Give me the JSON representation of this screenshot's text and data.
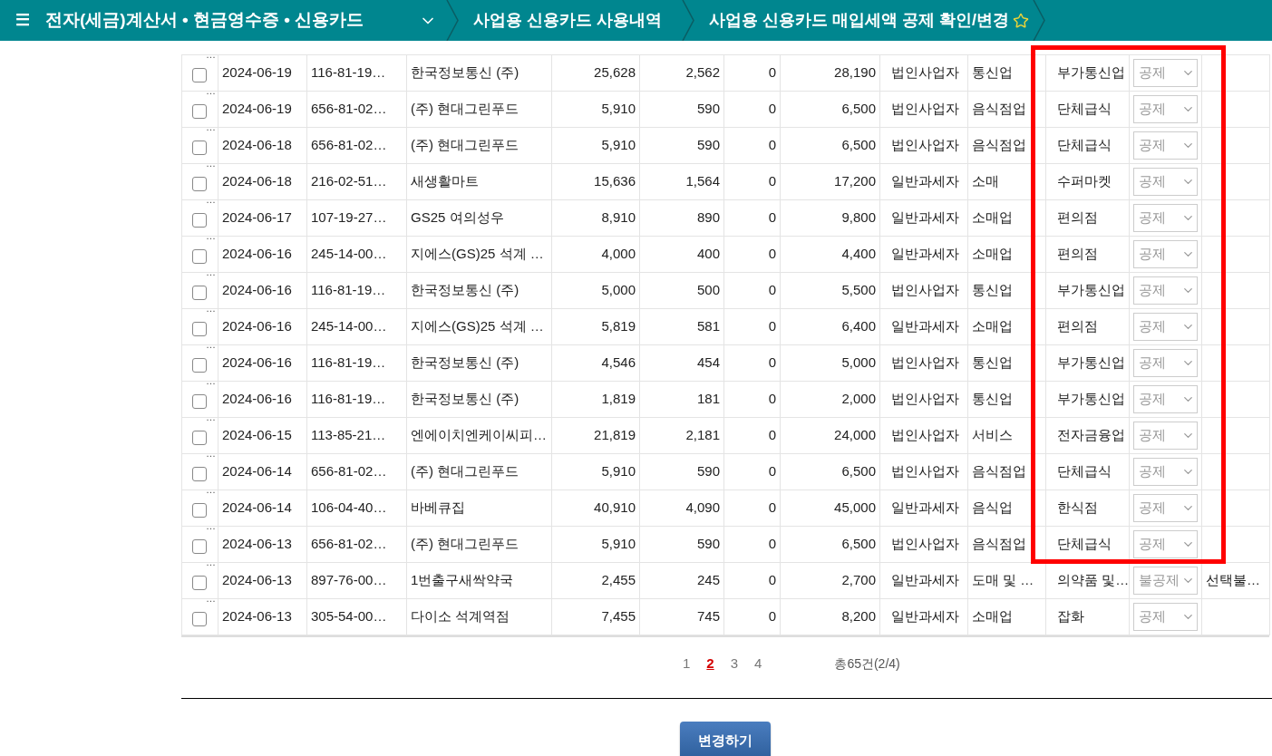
{
  "header": {
    "menu_icon": "☰",
    "title": "전자(세금)계산서 • 현금영수증 • 신용카드",
    "breadcrumbs": [
      {
        "label": "사업용 신용카드 사용내역",
        "favorite": false
      },
      {
        "label": "사업용 신용카드 매입세액 공제 확인/변경",
        "favorite": true
      }
    ]
  },
  "table": {
    "rows": [
      {
        "flag": "…",
        "checked": false,
        "date": "2024-06-19",
        "biz_no": "116-81-19…",
        "merchant": "한국정보통신 (주)",
        "supply": "25,628",
        "tax": "2,562",
        "service": "0",
        "total": "28,190",
        "taxpayer_type": "법인사업자",
        "industry": "통신업",
        "detail": "부가통신업",
        "deduction": "공제",
        "note": ""
      },
      {
        "flag": "…",
        "checked": false,
        "date": "2024-06-19",
        "biz_no": "656-81-02…",
        "merchant": "(주) 현대그린푸드",
        "supply": "5,910",
        "tax": "590",
        "service": "0",
        "total": "6,500",
        "taxpayer_type": "법인사업자",
        "industry": "음식점업",
        "detail": "단체급식",
        "deduction": "공제",
        "note": ""
      },
      {
        "flag": "…",
        "checked": false,
        "date": "2024-06-18",
        "biz_no": "656-81-02…",
        "merchant": "(주) 현대그린푸드",
        "supply": "5,910",
        "tax": "590",
        "service": "0",
        "total": "6,500",
        "taxpayer_type": "법인사업자",
        "industry": "음식점업",
        "detail": "단체급식",
        "deduction": "공제",
        "note": ""
      },
      {
        "flag": "…",
        "checked": false,
        "date": "2024-06-18",
        "biz_no": "216-02-51…",
        "merchant": "새생활마트",
        "supply": "15,636",
        "tax": "1,564",
        "service": "0",
        "total": "17,200",
        "taxpayer_type": "일반과세자",
        "industry": "소매",
        "detail": "수퍼마켓",
        "deduction": "공제",
        "note": ""
      },
      {
        "flag": "…",
        "checked": false,
        "date": "2024-06-17",
        "biz_no": "107-19-27…",
        "merchant": "GS25 여의성우",
        "supply": "8,910",
        "tax": "890",
        "service": "0",
        "total": "9,800",
        "taxpayer_type": "일반과세자",
        "industry": "소매업",
        "detail": "편의점",
        "deduction": "공제",
        "note": ""
      },
      {
        "flag": "…",
        "checked": false,
        "date": "2024-06-16",
        "biz_no": "245-14-00…",
        "merchant": "지에스(GS)25 석계 …",
        "supply": "4,000",
        "tax": "400",
        "service": "0",
        "total": "4,400",
        "taxpayer_type": "일반과세자",
        "industry": "소매업",
        "detail": "편의점",
        "deduction": "공제",
        "note": ""
      },
      {
        "flag": "…",
        "checked": false,
        "date": "2024-06-16",
        "biz_no": "116-81-19…",
        "merchant": "한국정보통신 (주)",
        "supply": "5,000",
        "tax": "500",
        "service": "0",
        "total": "5,500",
        "taxpayer_type": "법인사업자",
        "industry": "통신업",
        "detail": "부가통신업",
        "deduction": "공제",
        "note": ""
      },
      {
        "flag": "…",
        "checked": false,
        "date": "2024-06-16",
        "biz_no": "245-14-00…",
        "merchant": "지에스(GS)25 석계 …",
        "supply": "5,819",
        "tax": "581",
        "service": "0",
        "total": "6,400",
        "taxpayer_type": "일반과세자",
        "industry": "소매업",
        "detail": "편의점",
        "deduction": "공제",
        "note": ""
      },
      {
        "flag": "…",
        "checked": false,
        "date": "2024-06-16",
        "biz_no": "116-81-19…",
        "merchant": "한국정보통신 (주)",
        "supply": "4,546",
        "tax": "454",
        "service": "0",
        "total": "5,000",
        "taxpayer_type": "법인사업자",
        "industry": "통신업",
        "detail": "부가통신업",
        "deduction": "공제",
        "note": ""
      },
      {
        "flag": "…",
        "checked": false,
        "date": "2024-06-16",
        "biz_no": "116-81-19…",
        "merchant": "한국정보통신 (주)",
        "supply": "1,819",
        "tax": "181",
        "service": "0",
        "total": "2,000",
        "taxpayer_type": "법인사업자",
        "industry": "통신업",
        "detail": "부가통신업",
        "deduction": "공제",
        "note": ""
      },
      {
        "flag": "…",
        "checked": false,
        "date": "2024-06-15",
        "biz_no": "113-85-21…",
        "merchant": "엔에이치엔케이씨피…",
        "supply": "21,819",
        "tax": "2,181",
        "service": "0",
        "total": "24,000",
        "taxpayer_type": "법인사업자",
        "industry": "서비스",
        "detail": "전자금융업",
        "deduction": "공제",
        "note": ""
      },
      {
        "flag": "…",
        "checked": false,
        "date": "2024-06-14",
        "biz_no": "656-81-02…",
        "merchant": "(주) 현대그린푸드",
        "supply": "5,910",
        "tax": "590",
        "service": "0",
        "total": "6,500",
        "taxpayer_type": "법인사업자",
        "industry": "음식점업",
        "detail": "단체급식",
        "deduction": "공제",
        "note": ""
      },
      {
        "flag": "…",
        "checked": false,
        "date": "2024-06-14",
        "biz_no": "106-04-40…",
        "merchant": "바베큐집",
        "supply": "40,910",
        "tax": "4,090",
        "service": "0",
        "total": "45,000",
        "taxpayer_type": "일반과세자",
        "industry": "음식업",
        "detail": "한식점",
        "deduction": "공제",
        "note": ""
      },
      {
        "flag": "…",
        "checked": false,
        "date": "2024-06-13",
        "biz_no": "656-81-02…",
        "merchant": "(주) 현대그린푸드",
        "supply": "5,910",
        "tax": "590",
        "service": "0",
        "total": "6,500",
        "taxpayer_type": "법인사업자",
        "industry": "음식점업",
        "detail": "단체급식",
        "deduction": "공제",
        "note": ""
      },
      {
        "flag": "…",
        "checked": false,
        "date": "2024-06-13",
        "biz_no": "897-76-00…",
        "merchant": "1번출구새싹약국",
        "supply": "2,455",
        "tax": "245",
        "service": "0",
        "total": "2,700",
        "taxpayer_type": "일반과세자",
        "industry": "도매 및 …",
        "detail": "의약품 및…",
        "deduction": "불공제",
        "note": "선택불…"
      },
      {
        "flag": "…",
        "checked": false,
        "date": "2024-06-13",
        "biz_no": "305-54-00…",
        "merchant": "다이소 석계역점",
        "supply": "7,455",
        "tax": "745",
        "service": "0",
        "total": "8,200",
        "taxpayer_type": "일반과세자",
        "industry": "소매업",
        "detail": "잡화",
        "deduction": "공제",
        "note": ""
      }
    ]
  },
  "pagination": {
    "pages": [
      {
        "label": "1",
        "selected": false
      },
      {
        "label": "2",
        "selected": true
      },
      {
        "label": "3",
        "selected": false
      },
      {
        "label": "4",
        "selected": false
      }
    ],
    "summary": "총65건(2/4)"
  },
  "submit_button": "변경하기"
}
